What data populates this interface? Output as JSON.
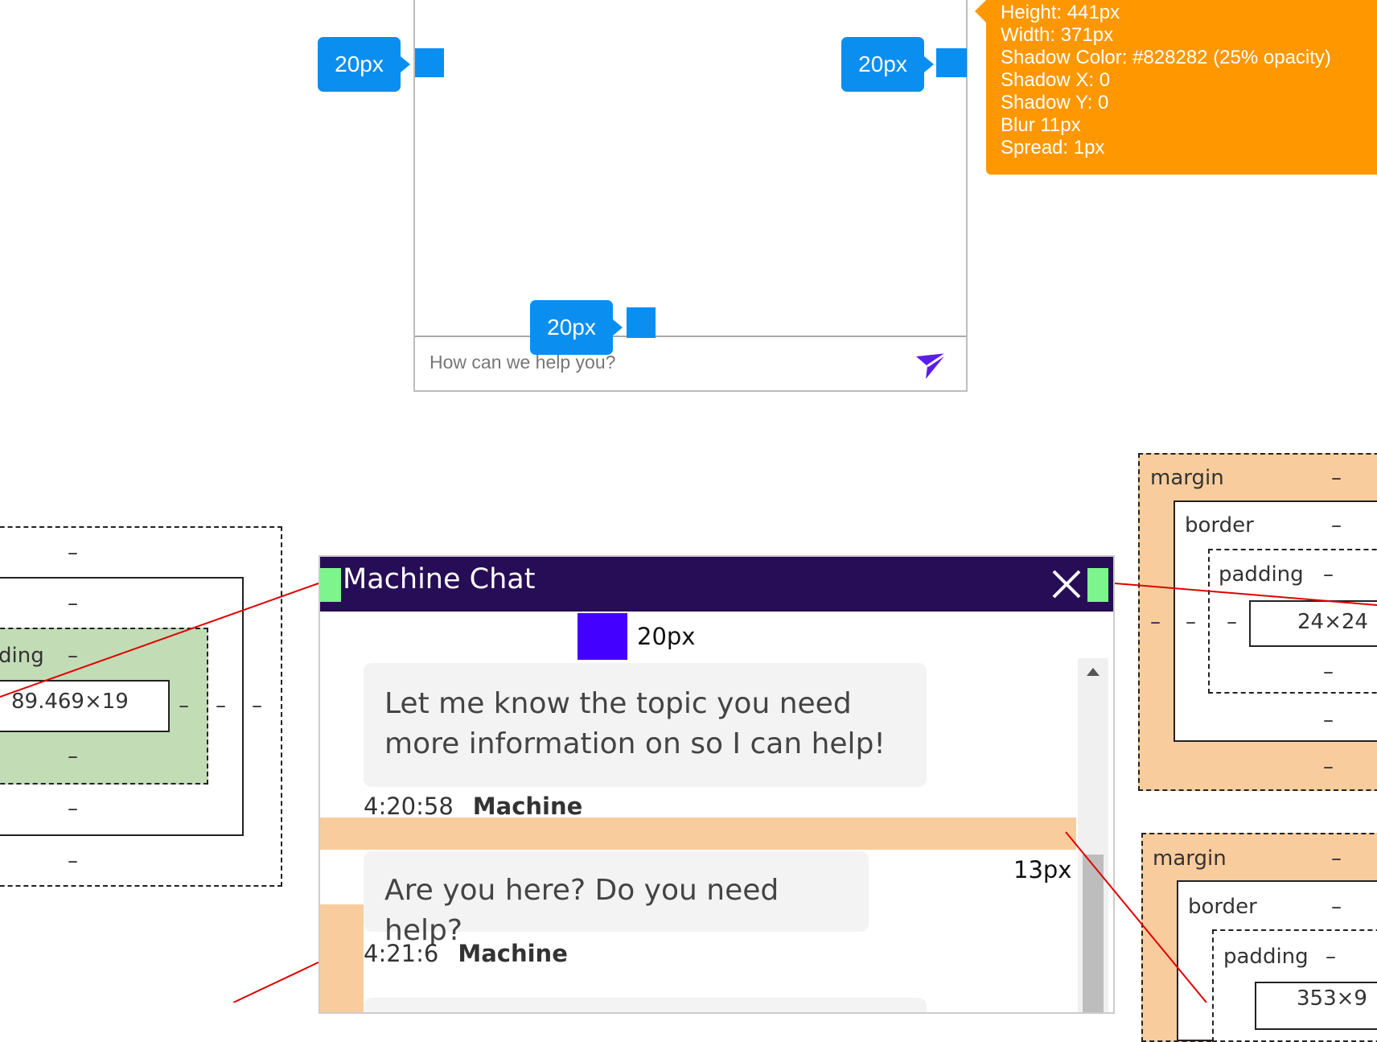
{
  "top_mock": {
    "input_placeholder": "How can we help you?",
    "callouts": [
      "20px",
      "20px",
      "20px"
    ],
    "spec_lines": [
      "Height: 441px",
      "Width: 371px",
      "Shadow Color: #828282 (25% opacity)",
      "Shadow X: 0",
      "Shadow Y: 0",
      "Blur 11px",
      "Spread: 1px"
    ],
    "colors": {
      "callout": "#0a8ff0",
      "spec": "#ff9800",
      "send": "#5b1cf0"
    }
  },
  "box_model_left": {
    "dash": "–",
    "padding_label": "ding",
    "content_size": "89.469×19"
  },
  "box_model_right_top": {
    "margin_label": "margin",
    "border_label": "border",
    "padding_label": "padding",
    "dash": "–",
    "content_size": "24×24"
  },
  "box_model_right_bottom": {
    "margin_label": "margin",
    "border_label": "border",
    "padding_label": "padding",
    "dash": "–",
    "content_size": "353×9"
  },
  "chat": {
    "title": "Machine Chat",
    "spacing_label": "20px",
    "gap_label": "13px",
    "messages": [
      {
        "text_line1": "Let me know the topic you need",
        "text_line2": "more information on so I can help!",
        "time": "4:20:58",
        "sender": "Machine"
      },
      {
        "text_line1": "Are you here? Do you need help?",
        "time": "4:21:6",
        "sender": "Machine"
      }
    ],
    "colors": {
      "header": "#260d55",
      "marker": "#4400ff",
      "margin": "#f9cc9d",
      "green": "#7df58c"
    }
  }
}
